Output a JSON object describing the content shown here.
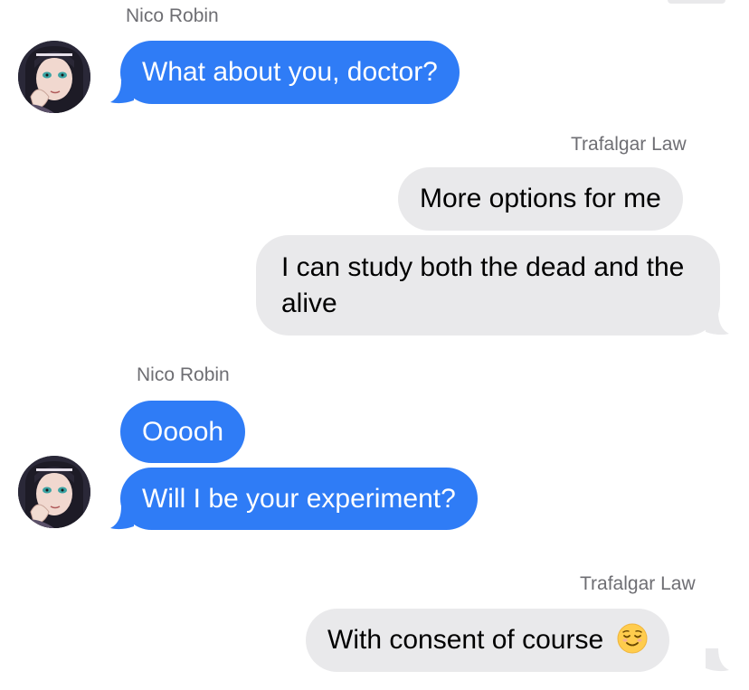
{
  "conversation": {
    "messages": [
      {
        "sender": "Nico Robin",
        "direction": "incoming",
        "text": "What about you, doctor?"
      },
      {
        "sender": "Trafalgar Law",
        "direction": "outgoing",
        "text": "More options for me"
      },
      {
        "sender": "Trafalgar Law",
        "direction": "outgoing",
        "text": "I can study both the dead and the alive"
      },
      {
        "sender": "Nico Robin",
        "direction": "incoming",
        "text": "Ooooh"
      },
      {
        "sender": "Nico Robin",
        "direction": "incoming",
        "text": "Will I be your experiment?"
      },
      {
        "sender": "Trafalgar Law",
        "direction": "outgoing",
        "text": "With consent of course",
        "emoji": "relieved-face"
      }
    ],
    "group_labels": [
      "Nico Robin",
      "Trafalgar Law",
      "Nico Robin",
      "Trafalgar Law"
    ]
  },
  "colors": {
    "incoming_bubble": "#2f7cf6",
    "outgoing_bubble": "#e9e9eb",
    "sender_name": "#6e6e73"
  }
}
